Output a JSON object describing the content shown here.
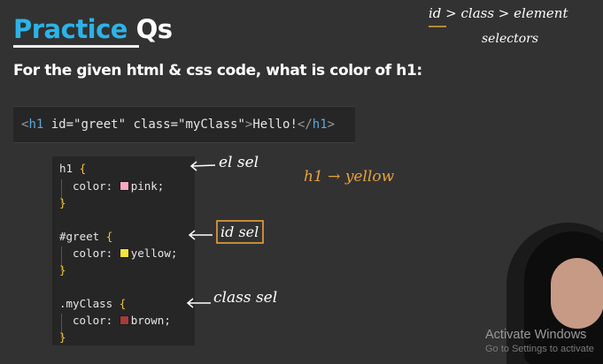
{
  "slide": {
    "title_part1": "Practice",
    "title_part2": "Qs",
    "question": "For the given html & css code, what is color of h1:"
  },
  "html_code": {
    "open_lt": "<",
    "tag": "h1",
    "attr1": " id=",
    "val1": "\"greet\"",
    "attr2": " class=",
    "val2": "\"myClass\"",
    "gt": ">",
    "text": "Hello!",
    "close": "</",
    "close_tag": "h1",
    "close_gt": ">"
  },
  "css_code": {
    "rule1": {
      "selector": "h1 ",
      "open": "{",
      "prop": "color: ",
      "value": "pink;",
      "close": "}",
      "swatch": "#f7a8c4"
    },
    "rule2": {
      "selector": "#greet ",
      "open": "{",
      "prop": "color: ",
      "value": "yellow;",
      "close": "}",
      "swatch": "#f5e33a"
    },
    "rule3": {
      "selector": ".myClass ",
      "open": "{",
      "prop": "color: ",
      "value": "brown;",
      "close": "}",
      "swatch": "#a83a3a"
    }
  },
  "annotations": {
    "el_sel": "el sel",
    "id_sel": "id sel",
    "class_sel": "class sel",
    "answer": "h1 → yellow",
    "hierarchy_line1": "id > class > element",
    "hierarchy_line2": "selectors"
  },
  "watermark": {
    "line1": "Activate Windows",
    "line2": "Go to Settings to activate"
  },
  "colors": {
    "title_accent": "#2bb4e8",
    "background": "#323232",
    "code_bg": "#262626",
    "handwriting_orange": "#e8a33a"
  }
}
